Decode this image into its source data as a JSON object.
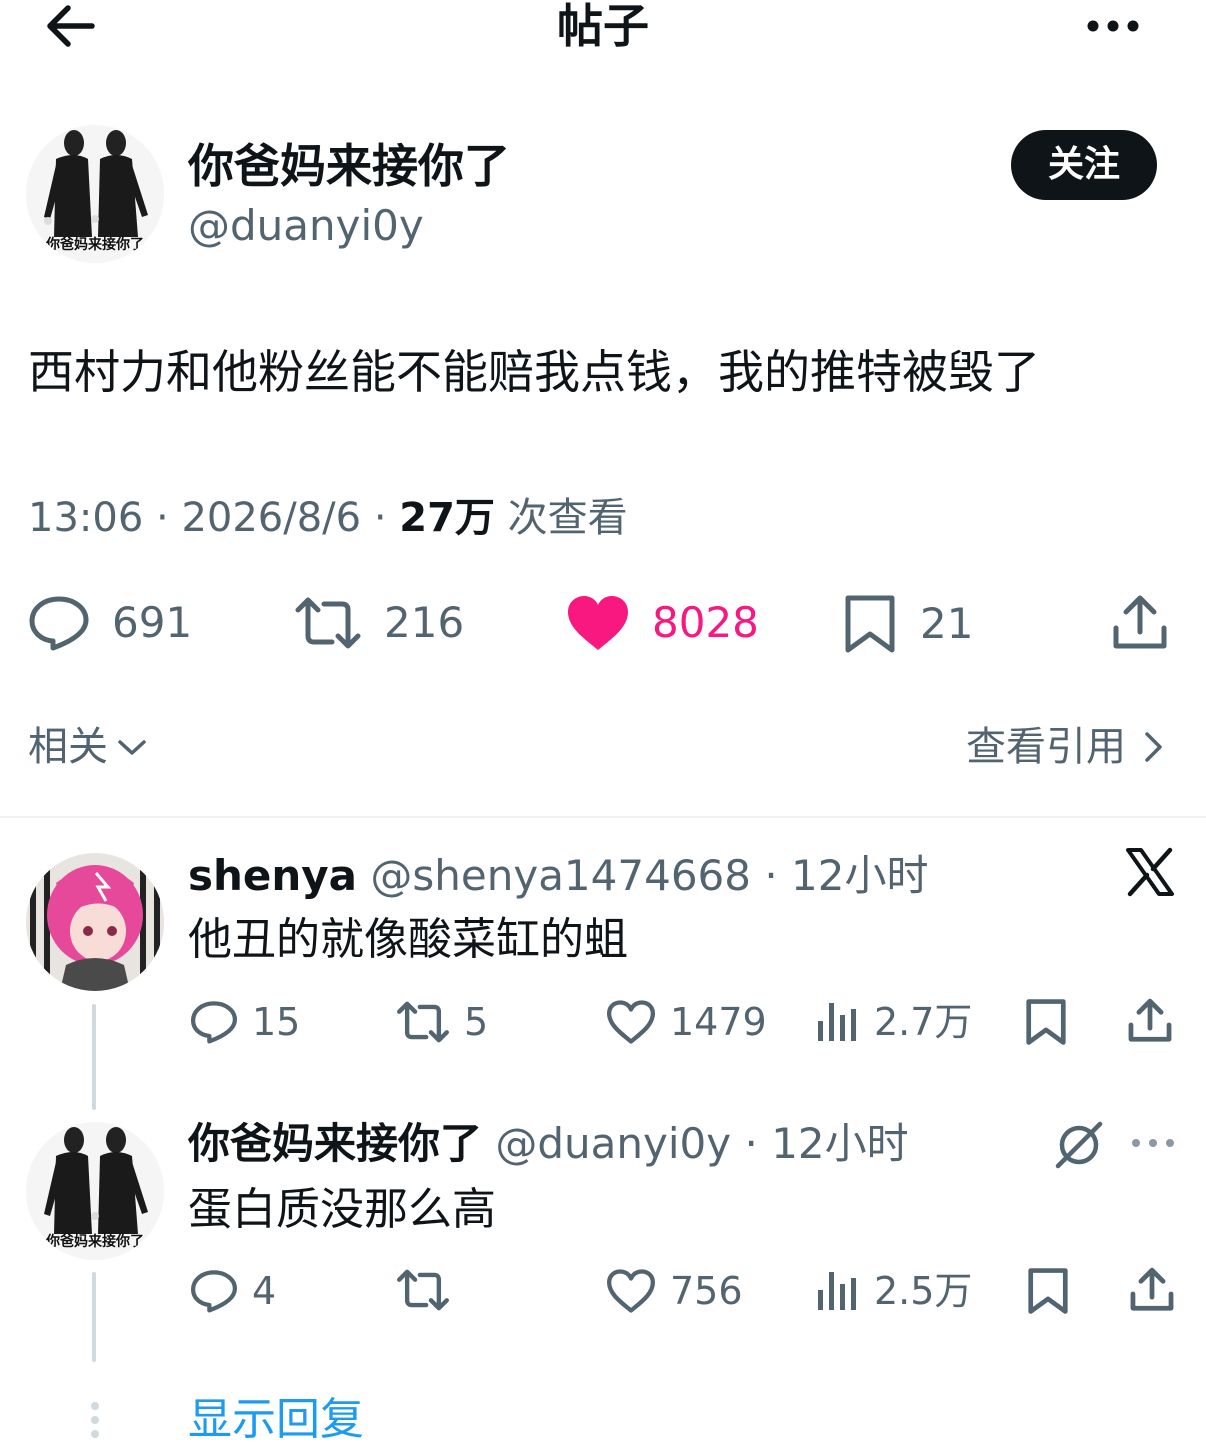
{
  "header": {
    "title": "帖子"
  },
  "post": {
    "author_name": "你爸妈来接你了",
    "author_handle": "@duanyi0y",
    "avatar_caption": "你爸妈来接你了",
    "follow_label": "关注",
    "text": "西村力和他粉丝能不能赔我点钱，我的推特被毁了",
    "time": "13:06",
    "date": "2026/8/6",
    "views": "27万",
    "views_suffix": "次查看",
    "replies": "691",
    "reposts": "216",
    "likes": "8028",
    "bookmarks": "21",
    "like_color": "#f91880"
  },
  "related": {
    "label": "相关",
    "quotes_label": "查看引用"
  },
  "replies": [
    {
      "name": "shenya",
      "handle": "@shenya1474668",
      "time": "12小时",
      "text": "他丑的就像酸菜缸的蛆",
      "replies": "15",
      "reposts": "5",
      "likes": "1479",
      "views": "2.7万"
    },
    {
      "name": "你爸妈来接你了",
      "handle": "@duanyi0y",
      "time": "12小时",
      "text": "蛋白质没那么高",
      "replies": "4",
      "reposts": "",
      "likes": "756",
      "views": "2.5万"
    }
  ],
  "show_replies_label": "显示回复"
}
